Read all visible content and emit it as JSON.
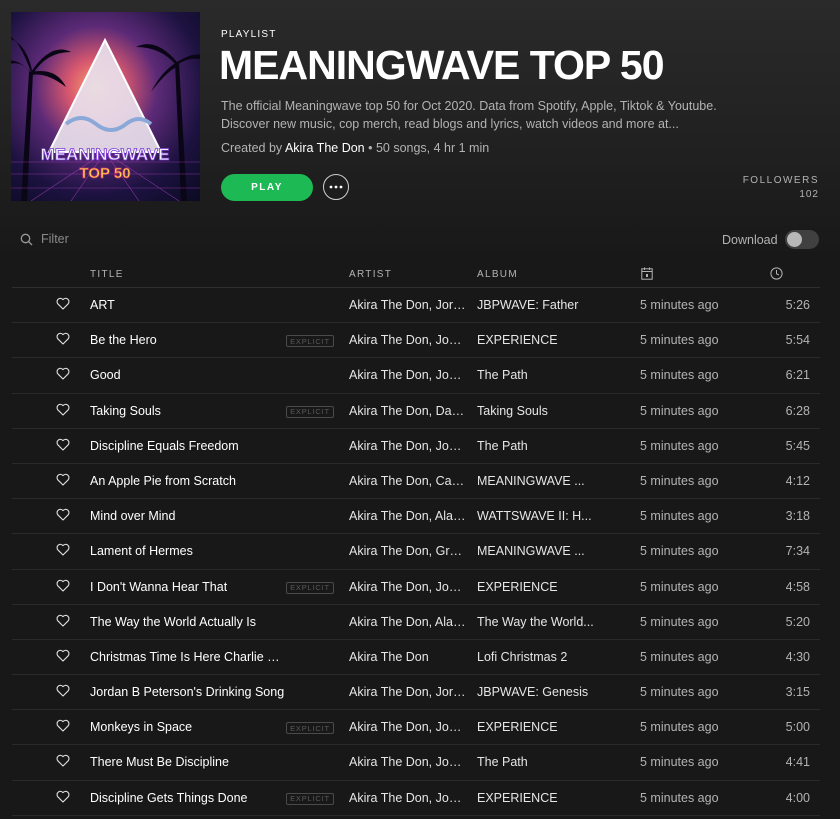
{
  "header": {
    "type_label": "PLAYLIST",
    "title": "MEANINGWAVE TOP 50",
    "description": "The official Meaningwave top 50 for Oct 2020. Data from Spotify, Apple, Tiktok & Youtube. Discover new music, cop merch, read blogs and lyrics, watch videos and more at...",
    "created_by_label": "Created by",
    "owner": "Akira The Don",
    "meta": " • 50 songs, 4 hr 1 min",
    "play_label": "PLAY",
    "followers_label": "FOLLOWERS",
    "followers_count": "102"
  },
  "cover": {
    "line1": "MEANINGWAVE",
    "line2": "TOP 50"
  },
  "filter": {
    "placeholder": "Filter"
  },
  "download": {
    "label": "Download",
    "enabled": false
  },
  "columns": {
    "title": "TITLE",
    "artist": "ARTIST",
    "album": "ALBUM",
    "date_icon": "calendar-icon",
    "duration_icon": "clock-icon"
  },
  "explicit_label": "EXPLICIT",
  "colors": {
    "accent": "#1db954",
    "background": "#181818"
  },
  "tracks": [
    {
      "title": "ART",
      "explicit": false,
      "artist": "Akira The Don, Jordan B Peterson",
      "album": "JBPWAVE: Father",
      "added": "5 minutes ago",
      "duration": "5:26"
    },
    {
      "title": "Be the Hero",
      "explicit": true,
      "artist": "Akira The Don, Joe Rogan",
      "album": "EXPERIENCE",
      "added": "5 minutes ago",
      "duration": "5:54"
    },
    {
      "title": "Good",
      "explicit": false,
      "artist": "Akira The Don, Jocko Willink",
      "album": "The Path",
      "added": "5 minutes ago",
      "duration": "6:21"
    },
    {
      "title": "Taking Souls",
      "explicit": true,
      "artist": "Akira The Don, David Goggins",
      "album": "Taking Souls",
      "added": "5 minutes ago",
      "duration": "6:28"
    },
    {
      "title": "Discipline Equals Freedom",
      "explicit": false,
      "artist": "Akira The Don, Jocko Willink",
      "album": "The Path",
      "added": "5 minutes ago",
      "duration": "5:45"
    },
    {
      "title": "An Apple Pie from Scratch",
      "explicit": false,
      "artist": "Akira The Don, Carl Sagan",
      "album": "MEANINGWAVE ...",
      "added": "5 minutes ago",
      "duration": "4:12"
    },
    {
      "title": "Mind over Mind",
      "explicit": false,
      "artist": "Akira The Don, Alan Watts",
      "album": "WATTSWAVE II: H...",
      "added": "5 minutes ago",
      "duration": "3:18"
    },
    {
      "title": "Lament of Hermes",
      "explicit": false,
      "artist": "Akira The Don, Graham Hancock",
      "album": "MEANINGWAVE ...",
      "added": "5 minutes ago",
      "duration": "7:34"
    },
    {
      "title": "I Don't Wanna Hear That",
      "explicit": true,
      "artist": "Akira The Don, Joe Rogan",
      "album": "EXPERIENCE",
      "added": "5 minutes ago",
      "duration": "4:58"
    },
    {
      "title": "The Way the World Actually Is",
      "explicit": false,
      "artist": "Akira The Don, Alan Watts",
      "album": "The Way the World...",
      "added": "5 minutes ago",
      "duration": "5:20"
    },
    {
      "title": "Christmas Time Is Here Charlie Brown",
      "explicit": false,
      "artist": "Akira The Don",
      "album": "Lofi Christmas 2",
      "added": "5 minutes ago",
      "duration": "4:30"
    },
    {
      "title": "Jordan B Peterson's Drinking Song",
      "explicit": false,
      "artist": "Akira The Don, Jordan B Peterson",
      "album": "JBPWAVE: Genesis",
      "added": "5 minutes ago",
      "duration": "3:15"
    },
    {
      "title": "Monkeys in Space",
      "explicit": true,
      "artist": "Akira The Don, Joe Rogan",
      "album": "EXPERIENCE",
      "added": "5 minutes ago",
      "duration": "5:00"
    },
    {
      "title": "There Must Be Discipline",
      "explicit": false,
      "artist": "Akira The Don, Jocko Willink",
      "album": "The Path",
      "added": "5 minutes ago",
      "duration": "4:41"
    },
    {
      "title": "Discipline Gets Things Done",
      "explicit": true,
      "artist": "Akira The Don, Joe Rogan",
      "album": "EXPERIENCE",
      "added": "5 minutes ago",
      "duration": "4:00"
    }
  ]
}
